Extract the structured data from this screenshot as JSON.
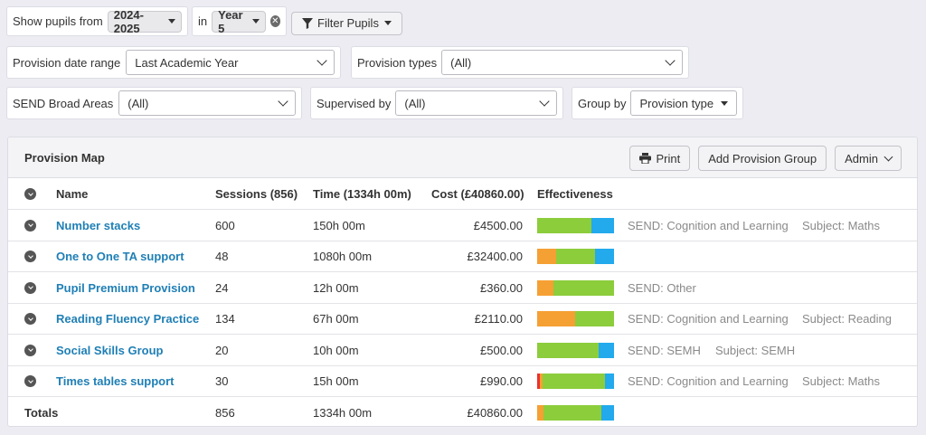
{
  "filters": {
    "show_pupils_label": "Show pupils from",
    "year_value": "2024-2025",
    "in_label": "in",
    "group_value": "Year 5",
    "filter_button": "Filter Pupils",
    "provision_date_label": "Provision date range",
    "provision_date_value": "Last Academic Year",
    "provision_types_label": "Provision types",
    "provision_types_value": "(All)",
    "send_label": "SEND Broad Areas",
    "send_value": "(All)",
    "supervised_label": "Supervised by",
    "supervised_value": "(All)",
    "group_by_label": "Group by",
    "group_by_value": "Provision type"
  },
  "panel": {
    "title": "Provision Map",
    "print_label": "Print",
    "add_group_label": "Add Provision Group",
    "admin_label": "Admin"
  },
  "table": {
    "headers": {
      "name": "Name",
      "sessions": "Sessions (856)",
      "time": "Time (1334h 00m)",
      "cost": "Cost (£40860.00)",
      "effectiveness": "Effectiveness"
    },
    "rows": [
      {
        "name": "Number stacks",
        "sessions": "600",
        "time": "150h 00m",
        "cost": "£4500.00",
        "tag1": "SEND: Cognition and Learning",
        "tag2": "Subject: Maths",
        "eff": {
          "red": 0,
          "orange": 0,
          "green": 0.7,
          "blue": 0.3
        }
      },
      {
        "name": "One to One TA support",
        "sessions": "48",
        "time": "1080h 00m",
        "cost": "£32400.00",
        "tag1": "",
        "tag2": "",
        "eff": {
          "red": 0,
          "orange": 0.25,
          "green": 0.5,
          "blue": 0.25
        }
      },
      {
        "name": "Pupil Premium Provision",
        "sessions": "24",
        "time": "12h 00m",
        "cost": "£360.00",
        "tag1": "SEND: Other",
        "tag2": "",
        "eff": {
          "red": 0,
          "orange": 0.21,
          "green": 0.79,
          "blue": 0
        }
      },
      {
        "name": "Reading Fluency Practice",
        "sessions": "134",
        "time": "67h 00m",
        "cost": "£2110.00",
        "tag1": "SEND: Cognition and Learning",
        "tag2": "Subject: Reading",
        "eff": {
          "red": 0,
          "orange": 0.49,
          "green": 0.51,
          "blue": 0
        }
      },
      {
        "name": "Social Skills Group",
        "sessions": "20",
        "time": "10h 00m",
        "cost": "£500.00",
        "tag1": "SEND: SEMH",
        "tag2": "Subject: SEMH",
        "eff": {
          "red": 0,
          "orange": 0,
          "green": 0.8,
          "blue": 0.2
        }
      },
      {
        "name": "Times tables support",
        "sessions": "30",
        "time": "15h 00m",
        "cost": "£990.00",
        "tag1": "SEND: Cognition and Learning",
        "tag2": "Subject: Maths",
        "eff": {
          "red": 0.04,
          "orange": 0.03,
          "green": 0.81,
          "blue": 0.12
        }
      }
    ],
    "totals": {
      "label": "Totals",
      "sessions": "856",
      "time": "1334h 00m",
      "cost": "£40860.00",
      "eff": {
        "red": 0,
        "orange": 0.08,
        "green": 0.76,
        "blue": 0.16
      }
    }
  },
  "colors": {
    "red": "#e8332e",
    "orange": "#f5a033",
    "green": "#8ccd3c",
    "blue": "#22aaed",
    "link": "#1f7fb5"
  }
}
